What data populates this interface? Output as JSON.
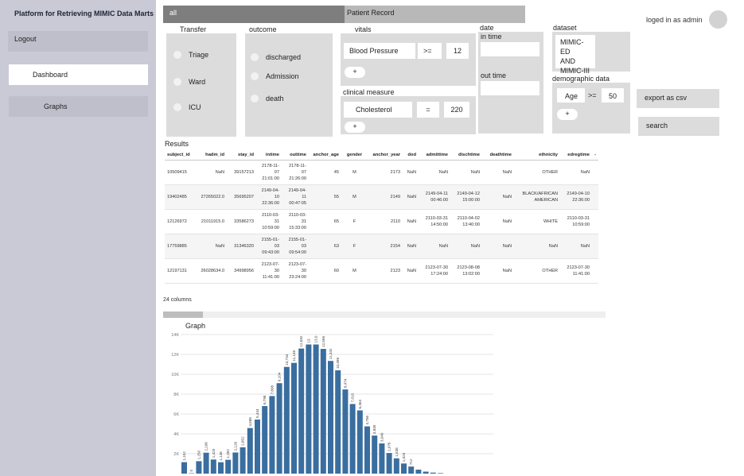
{
  "app": {
    "title": "Platform for Retrieving MIMIC Data Marts",
    "login_text": "loged in as admin"
  },
  "sidebar": {
    "logout": "Logout",
    "items": [
      {
        "label": "Dashboard"
      },
      {
        "label": "Graphs"
      }
    ]
  },
  "tabs": [
    {
      "label": "all"
    },
    {
      "label": "Patient Record"
    }
  ],
  "filters": {
    "transfer": {
      "title": "Transfer",
      "options": [
        "Triage",
        "Ward",
        "ICU"
      ]
    },
    "outcome": {
      "title": "outcome",
      "options": [
        "discharged",
        "Admission",
        "death"
      ]
    },
    "vitals": {
      "title": "vitals",
      "field": "Blood Pressure",
      "operator": ">=",
      "value": "12",
      "add": "+"
    },
    "clinical": {
      "title": "clinical measure",
      "field": "Cholesterol",
      "operator": "=",
      "value": "220",
      "add": "+"
    },
    "date": {
      "title": "date",
      "in_time": "in time",
      "out_time": "out time"
    },
    "dataset": {
      "title": "dataset",
      "items": [
        "MIMIC-ED",
        "AND",
        "MIMIC-III"
      ]
    },
    "demographic": {
      "title": "demographic data",
      "field": "Age",
      "operator": ">=",
      "value": "50",
      "add": "+"
    }
  },
  "actions": {
    "export": "export as csv",
    "search": "search"
  },
  "results": {
    "title": "Results",
    "columns": [
      "subject_id",
      "hadm_id",
      "stay_id",
      "intime",
      "outtime",
      "anchor_age",
      "gender",
      "anchor_year",
      "dod",
      "admittime",
      "dischtime",
      "deathtime",
      "ethnicity",
      "edregtime",
      "-"
    ],
    "rows": [
      [
        "10509415",
        "NaN",
        "39157213",
        "2178-11-07 21:01:00",
        "2178-11-07 21:26:00",
        "45",
        "M",
        "2173",
        "NaN",
        "NaN",
        "NaN",
        "NaN",
        "OTHER",
        "NaN",
        ""
      ],
      [
        "19402485",
        "27265022.0",
        "35695207",
        "2149-04-10 22:36:00",
        "2149-04-11 00:47:05",
        "55",
        "M",
        "2149",
        "NaN",
        "2149-04-11 00:46:00",
        "2149-04-12 15:00:00",
        "NaN",
        "BLACK/AFRICAN AMERICAN",
        "2149-04-10 22:36:00",
        ""
      ],
      [
        "12126972",
        "21011915.0",
        "33586273",
        "2110-03-31 10:59:00",
        "2110-03-31 15:33:00",
        "65",
        "F",
        "2110",
        "NaN",
        "2110-03-31 14:50:00",
        "2110-04-02 13:40:00",
        "NaN",
        "WHITE",
        "2110-03-31 10:59:00",
        ""
      ],
      [
        "17759885",
        "NaN",
        "31346320",
        "2155-01-03 09:43:00",
        "2155-01-03 09:54:00",
        "63",
        "F",
        "2154",
        "NaN",
        "NaN",
        "NaN",
        "NaN",
        "NaN",
        "NaN",
        ""
      ],
      [
        "12197131",
        "26028634.0",
        "34998956",
        "2123-07-30 11:41:00",
        "2123-07-30 23:24:00",
        "60",
        "M",
        "2123",
        "NaN",
        "2123-07-30 17:24:00",
        "2123-08-08 13:02:00",
        "NaN",
        "OTHER",
        "2123-07-30 11:41:00",
        ""
      ]
    ],
    "column_count": "24 columns"
  },
  "graph": {
    "title": "Graph"
  },
  "chart_data": {
    "type": "bar",
    "color": "#3a6e9f",
    "values": [
      1152,
      0,
      1250,
      2106,
      1420,
      1146,
      1392,
      2126,
      2652,
      4588,
      5444,
      6798,
      7808,
      9104,
      10744,
      11148,
      12592,
      13000,
      13000,
      12556,
      11342,
      10398,
      8474,
      7010,
      6364,
      4756,
      3830,
      3040,
      2076,
      1538,
      1020,
      712,
      400,
      200,
      100,
      50
    ],
    "data_labels": [
      "1,152",
      "0",
      "1,250",
      "2,106",
      "1,420",
      "1,146",
      "1,392",
      "2,126",
      "2,652",
      "4,588",
      "5,444",
      "6,798",
      "7,808",
      "9,104",
      "10,744",
      "11,148",
      "12,592",
      "13",
      "13,0",
      "12,556",
      "11,342",
      "10,398",
      "8,474",
      "7,010",
      "6,364",
      "4,756",
      "3,830",
      "3,040",
      "2,076",
      "1,538",
      "1,020",
      "712",
      "",
      "",
      "",
      ""
    ],
    "yticks": [
      {
        "value": 2000,
        "label": "2K"
      },
      {
        "value": 4000,
        "label": "4K"
      },
      {
        "value": 6000,
        "label": "6K"
      },
      {
        "value": 8000,
        "label": "8K"
      },
      {
        "value": 10000,
        "label": "10K"
      },
      {
        "value": 12000,
        "label": "12K"
      },
      {
        "value": 14000,
        "label": "14K"
      }
    ],
    "ylim": [
      0,
      14000
    ],
    "grid": true,
    "title": "",
    "xlabel": "",
    "ylabel": ""
  }
}
